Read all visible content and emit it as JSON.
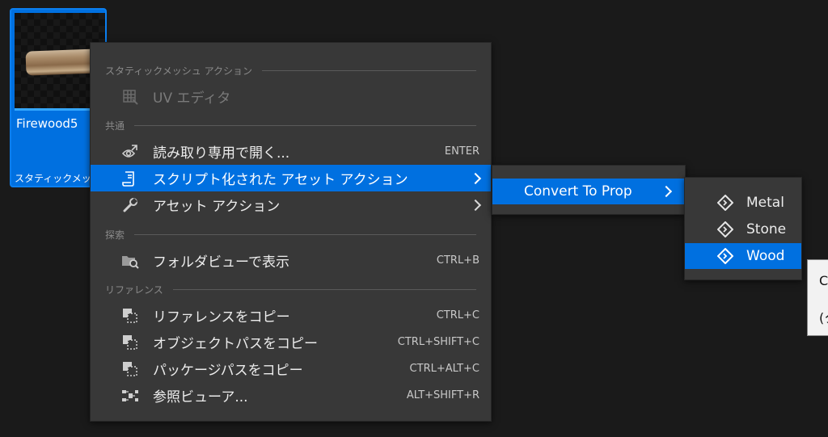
{
  "asset": {
    "name": "Firewood5",
    "type": "スタティックメッシュ"
  },
  "main_menu": {
    "sections": {
      "static_mesh": "スタティックメッシュ アクション",
      "common": "共通",
      "explore": "探索",
      "references": "リファレンス"
    },
    "items": [
      {
        "label": "UV エディタ",
        "shortcut": "",
        "icon": "uv-grid-icon"
      },
      {
        "label": "読み取り専用で開く...",
        "shortcut": "ENTER",
        "icon": "open-readonly-icon"
      },
      {
        "label": "スクリプト化された アセット アクション",
        "shortcut": "",
        "icon": "script-icon"
      },
      {
        "label": "アセット アクション",
        "shortcut": "",
        "icon": "wrench-icon"
      },
      {
        "label": "フォルダビューで表示",
        "shortcut": "CTRL+B",
        "icon": "folder-search-icon"
      },
      {
        "label": "リファレンスをコピー",
        "shortcut": "CTRL+C",
        "icon": "copy-reference-icon"
      },
      {
        "label": "オブジェクトパスをコピー",
        "shortcut": "CTRL+SHIFT+C",
        "icon": "copy-path-icon"
      },
      {
        "label": "パッケージパスをコピー",
        "shortcut": "CTRL+ALT+C",
        "icon": "copy-package-icon"
      },
      {
        "label": "参照ビューア...",
        "shortcut": "ALT+SHIFT+R",
        "icon": "reference-viewer-icon"
      }
    ]
  },
  "submenu1": {
    "items": [
      {
        "label": "Convert To Prop"
      }
    ]
  },
  "submenu2": {
    "items": [
      {
        "label": "Metal",
        "icon": "action-diamond-icon"
      },
      {
        "label": "Stone",
        "icon": "action-diamond-icon"
      },
      {
        "label": "Wood",
        "icon": "action-diamond-icon"
      }
    ]
  },
  "tooltip": {
    "line1": "C",
    "line2": "(ク"
  },
  "colors": {
    "accent": "#0070e0",
    "menu_bg": "#383838",
    "background": "#1a1a1a"
  }
}
